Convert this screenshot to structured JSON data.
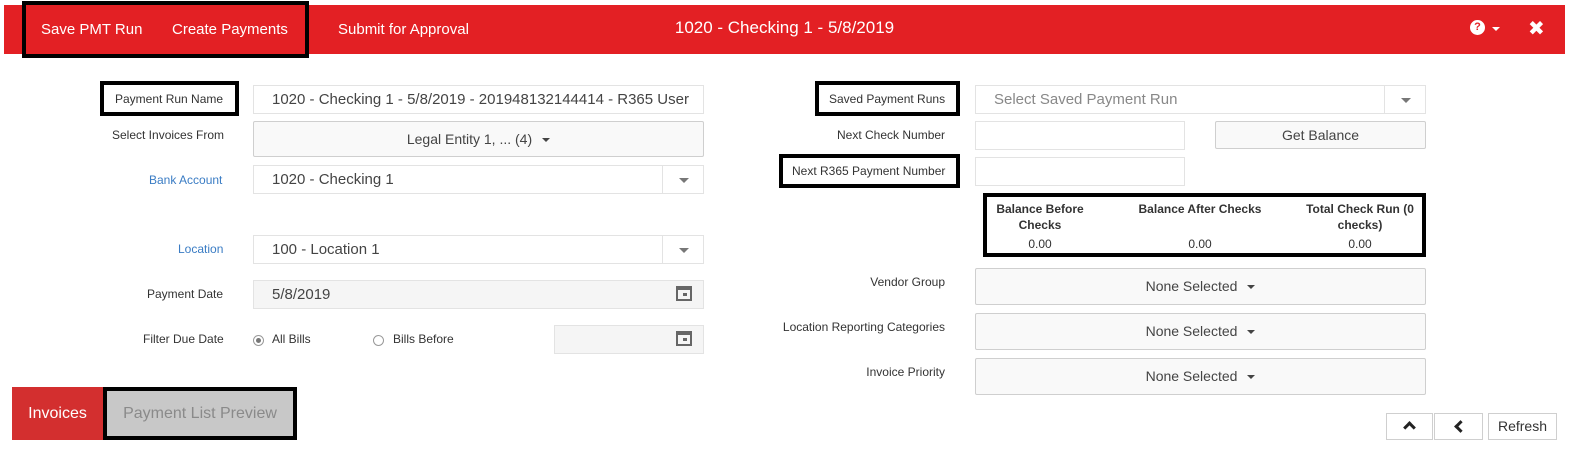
{
  "header": {
    "save_label": "Save PMT Run",
    "create_label": "Create Payments",
    "submit_label": "Submit for Approval",
    "title": "1020 - Checking 1 - 5/8/2019",
    "help_glyph": "?",
    "close_glyph": "✖",
    "bar_color": "#e32024"
  },
  "form": {
    "payment_run_name_label": "Payment Run Name",
    "payment_run_name_value": "1020 - Checking 1 - 5/8/2019 - 201948132144414 - R365 User",
    "select_invoices_label": "Select Invoices From",
    "select_invoices_value": "Legal Entity 1, ... (4)",
    "bank_account_label": "Bank Account",
    "bank_account_value": "1020 - Checking 1",
    "location_label": "Location",
    "location_value": "100 - Location 1",
    "payment_date_label": "Payment Date",
    "payment_date_value": "5/8/2019",
    "filter_due_date_label": "Filter Due Date",
    "filter_options": [
      "All Bills",
      "Bills Before"
    ],
    "filter_selected": "All Bills",
    "bills_before_value": ""
  },
  "right": {
    "saved_runs_label": "Saved Payment Runs",
    "saved_runs_placeholder": "Select Saved Payment Run",
    "next_check_label": "Next Check Number",
    "next_check_value": "",
    "get_balance_label": "Get Balance",
    "next_r365_label": "Next R365 Payment Number",
    "next_r365_value": "",
    "balance": {
      "before_label": "Balance Before Checks",
      "after_label": "Balance After Checks",
      "total_label": "Total Check Run (0 checks)",
      "before_value": "0.00",
      "after_value": "0.00",
      "total_value": "0.00"
    },
    "vendor_group_label": "Vendor Group",
    "vendor_group_value": "None Selected",
    "loc_reporting_label": "Location Reporting Categories",
    "loc_reporting_value": "None Selected",
    "invoice_priority_label": "Invoice Priority",
    "invoice_priority_value": "None Selected"
  },
  "tabs": {
    "invoices": "Invoices",
    "payment_list_preview": "Payment List Preview",
    "active_color": "#d32f2f"
  },
  "footer": {
    "refresh_label": "Refresh",
    "up_icon": "chevron-up-icon",
    "left_icon": "chevron-left-icon"
  }
}
